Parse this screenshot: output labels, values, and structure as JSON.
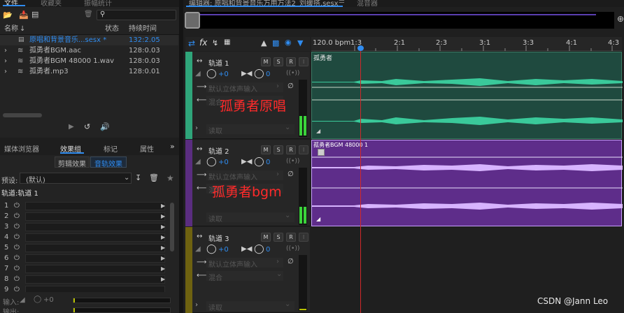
{
  "top_left_tabs": [
    "文件",
    "收藏夹",
    "振幅统计"
  ],
  "editor_tab": "编辑器: 原唱和背景音乐万用万法2_刘缓搭.sesx",
  "editor_tab2": "混音器",
  "files": {
    "col_name": "名称",
    "col_status": "状态",
    "col_duration": "持续时间",
    "items": [
      {
        "name": "原唱和背景音乐...sesx *",
        "duration": "132:2.05",
        "active": true
      },
      {
        "name": "孤勇者BGM.aac",
        "duration": "128:0.03",
        "active": false
      },
      {
        "name": "孤勇者BGM 48000 1.wav",
        "duration": "128:0.03",
        "active": false
      },
      {
        "name": "孤勇者.mp3",
        "duration": "128:0.01",
        "active": false
      }
    ]
  },
  "lower_tabs": [
    "媒体浏览器",
    "效果组",
    "标记",
    "属性"
  ],
  "sub_tabs": [
    "剪辑效果",
    "音轨效果"
  ],
  "preset_label": "预设:",
  "preset_value": "(默认)",
  "track_label": "轨道:轨道 1",
  "fx_slots": [
    "1",
    "2",
    "3",
    "4",
    "5",
    "6",
    "7",
    "8",
    "9"
  ],
  "input_label": "输入:",
  "input_value": "+0",
  "output_label": "输出:",
  "ruler": {
    "bpm": "120.0 bpm",
    "ticks": [
      "1:3",
      "2:1",
      "2:3",
      "3:1",
      "3:3",
      "4:1",
      "4:3"
    ]
  },
  "tracks": [
    {
      "name": "轨道 1",
      "vol": "+0",
      "pan": "0",
      "input": "默认立体声输入",
      "output": "混合",
      "read": "读取",
      "clip": "孤勇者",
      "annotation": "孤勇者原唱",
      "color": "#2fa57a"
    },
    {
      "name": "轨道 2",
      "vol": "+0",
      "pan": "0",
      "input": "默认立体声输入",
      "output": "混合",
      "read": "读取",
      "clip": "孤勇者BGM 48000 1",
      "annotation": "孤勇者bgm",
      "color": "#7a3fa8"
    },
    {
      "name": "轨道 3",
      "vol": "+0",
      "pan": "0",
      "input": "默认立体声输入",
      "output": "混合",
      "read": "读取",
      "clip": "",
      "annotation": "",
      "color": "#8a7a10"
    }
  ],
  "msr": [
    "M",
    "S",
    "R",
    "I"
  ],
  "watermark": "CSDN @Jann Leo",
  "colors": {
    "accent": "#2f8cf0",
    "annotation": "#ff2a2a",
    "playhead": "#d0282a"
  }
}
